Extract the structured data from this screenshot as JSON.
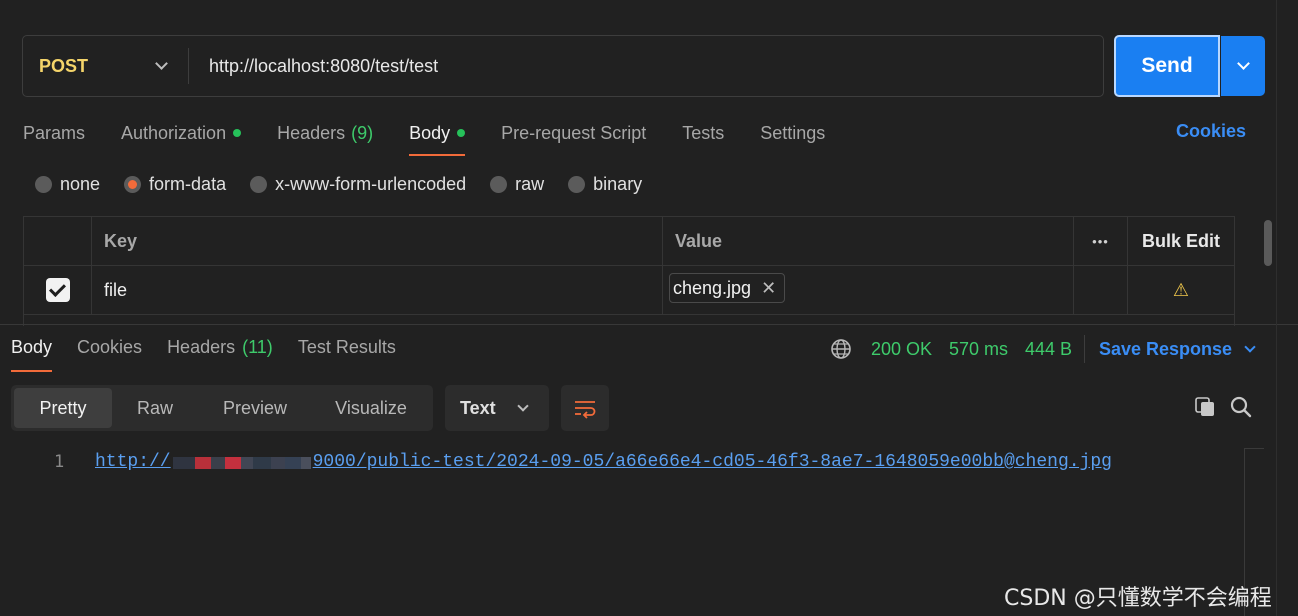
{
  "request": {
    "method": "POST",
    "url": "http://localhost:8080/test/test",
    "send_label": "Send"
  },
  "request_tabs": [
    {
      "label": "Params",
      "dot": false,
      "count": ""
    },
    {
      "label": "Authorization",
      "dot": true,
      "count": ""
    },
    {
      "label": "Headers",
      "dot": false,
      "count": "(9)"
    },
    {
      "label": "Body",
      "dot": true,
      "count": "",
      "active": true
    },
    {
      "label": "Pre-request Script",
      "dot": false,
      "count": ""
    },
    {
      "label": "Tests",
      "dot": false,
      "count": ""
    },
    {
      "label": "Settings",
      "dot": false,
      "count": ""
    }
  ],
  "cookies_link": "Cookies",
  "body_types": [
    {
      "label": "none",
      "selected": false
    },
    {
      "label": "form-data",
      "selected": true
    },
    {
      "label": "x-www-form-urlencoded",
      "selected": false
    },
    {
      "label": "raw",
      "selected": false
    },
    {
      "label": "binary",
      "selected": false
    }
  ],
  "form_table": {
    "headers": {
      "key": "Key",
      "value": "Value",
      "more": "•••",
      "bulk_edit": "Bulk Edit"
    },
    "rows": [
      {
        "checked": true,
        "key": "file",
        "value": "cheng.jpg",
        "remove": "✕",
        "warning": "⚠"
      }
    ]
  },
  "response_tabs": [
    {
      "label": "Body",
      "count": "",
      "active": true
    },
    {
      "label": "Cookies",
      "count": ""
    },
    {
      "label": "Headers",
      "count": "(11)"
    },
    {
      "label": "Test Results",
      "count": ""
    }
  ],
  "response_meta": {
    "status": "200 OK",
    "time": "570 ms",
    "size": "444 B",
    "save_label": "Save Response"
  },
  "view_modes": [
    "Pretty",
    "Raw",
    "Preview",
    "Visualize"
  ],
  "active_view": "Pretty",
  "format": "Text",
  "response_body": {
    "line_number": "1",
    "prefix": "http://",
    "suffix": "9000/public-test/2024-09-05/a66e66e4-cd05-46f3-8ae7-1648059e00bb@cheng.jpg"
  },
  "watermark": "CSDN @只懂数学不会编程",
  "colors": {
    "accent": "#f26b3a",
    "send": "#1a7ff2",
    "success": "#3ecb6b",
    "link": "#3a8df5",
    "method": "#f4d46a"
  }
}
